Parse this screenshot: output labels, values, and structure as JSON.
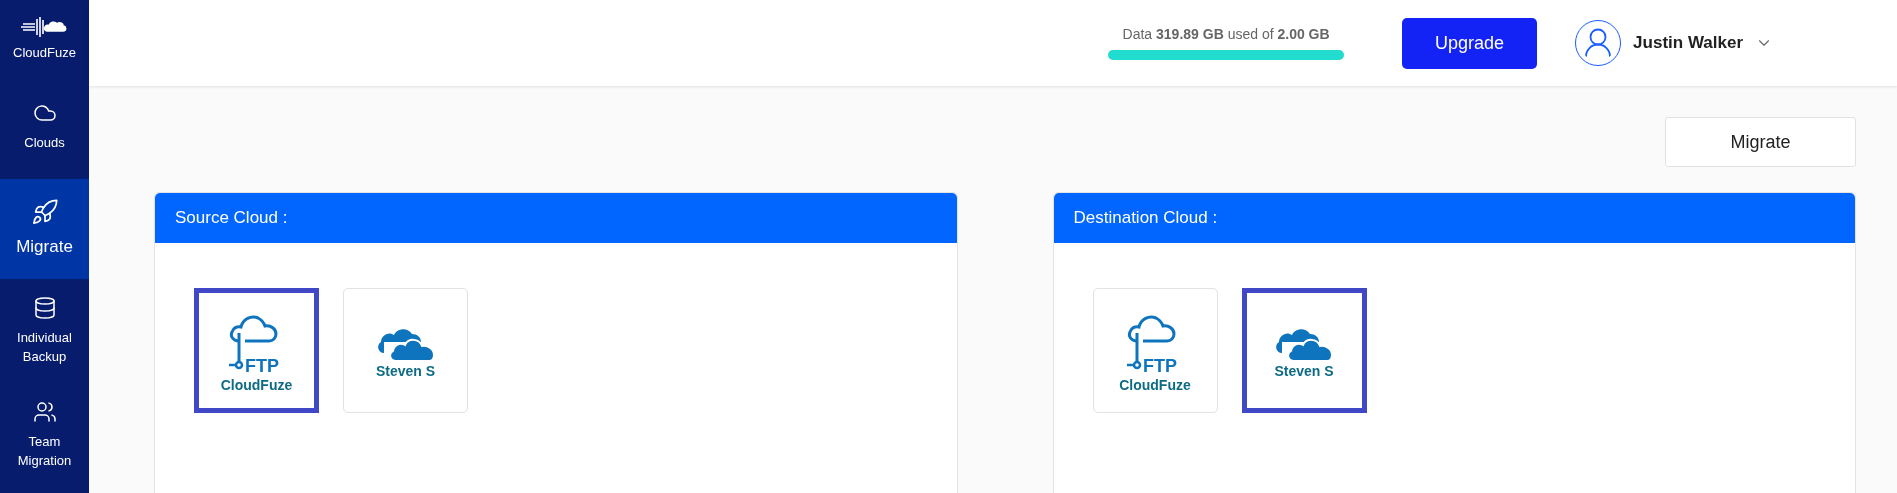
{
  "sidebar": {
    "logo": {
      "label": "CloudFuze"
    },
    "items": [
      {
        "label": "Clouds",
        "kind": "cloud",
        "selected": false
      },
      {
        "label": "Migrate",
        "kind": "rocket",
        "selected": true
      },
      {
        "label": "Individual Backup",
        "kind": "database",
        "selected": false
      },
      {
        "label": "Team Migration",
        "kind": "users",
        "selected": false
      }
    ]
  },
  "header": {
    "usage": {
      "text": "Data **319.89 GB** used of **2.00 GB**",
      "level": 1
    },
    "upgrade_button": "Upgrade",
    "user": {
      "name": "Justin Walker"
    }
  },
  "migrate_button": "Migrate",
  "panels": [
    {
      "title": "Source Cloud :",
      "clouds": [
        {
          "name": "CloudFuze",
          "kind": "ftp",
          "icon_text": "FTP",
          "selected": true
        },
        {
          "name": "Steven S",
          "kind": "onedrive",
          "selected": false
        }
      ]
    },
    {
      "title": "Destination Cloud :",
      "clouds": [
        {
          "name": "CloudFuze",
          "kind": "ftp",
          "icon_text": "FTP",
          "selected": false
        },
        {
          "name": "Steven S",
          "kind": "onedrive",
          "selected": true
        }
      ]
    }
  ]
}
